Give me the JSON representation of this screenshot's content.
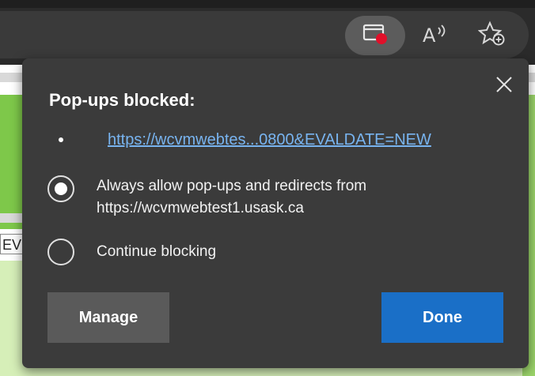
{
  "toolbar": {
    "icons": [
      "popup-blocked-icon",
      "read-aloud-icon",
      "add-favorite-icon"
    ],
    "read_aloud_label": "A"
  },
  "page": {
    "edge_text": "EV"
  },
  "popup": {
    "title": "Pop-ups blocked:",
    "blocked_url": "https://wcvmwebtes...0800&EVALDATE=NEW",
    "options": [
      {
        "label_line1": "Always allow pop-ups and redirects from",
        "label_line2": "https://wcvmwebtest1.usask.ca",
        "selected": true
      },
      {
        "label_line1": "Continue blocking",
        "selected": false
      }
    ],
    "manage_label": "Manage",
    "done_label": "Done"
  },
  "colors": {
    "accent": "#1a6fc7",
    "link": "#78b4f0",
    "popup_indicator": "#e0102a"
  }
}
